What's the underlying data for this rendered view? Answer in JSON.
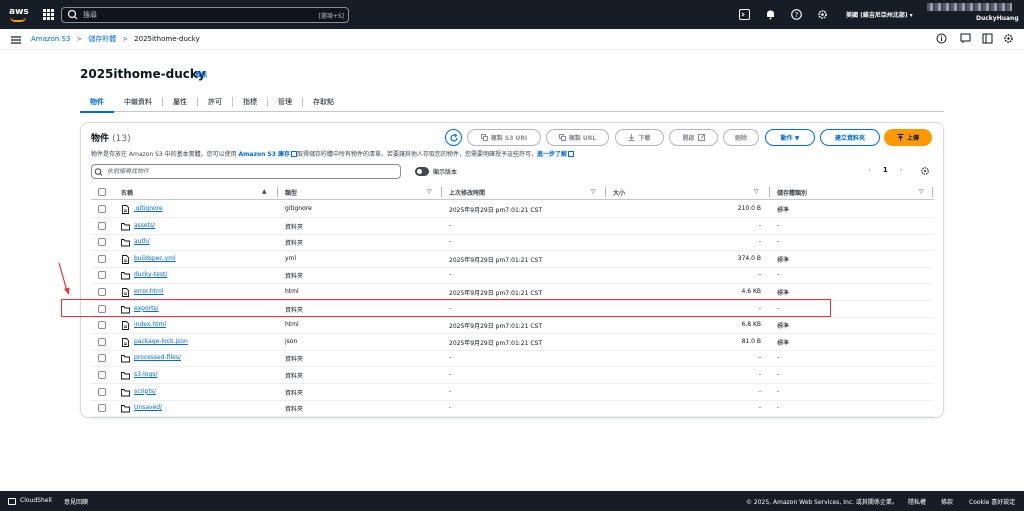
{
  "topnav": {
    "logo_text": "aws",
    "search_placeholder": "搜尋",
    "search_shortcut": "[選項+S]",
    "region": "美國 (維吉尼亞州北部) ▾",
    "username": "DuckyHuang"
  },
  "breadcrumb": {
    "items": [
      "Amazon S3",
      "儲存貯體",
      "2025ithome-ducky"
    ],
    "separator": ">"
  },
  "page": {
    "title": "2025ithome-ducky",
    "info": "資訊"
  },
  "tabs": [
    "物件",
    "中繼資料",
    "屬性",
    "許可",
    "指標",
    "管理",
    "存取點"
  ],
  "objects": {
    "title": "物件",
    "count": "(13)",
    "desc_pre": "物件是存放在 Amazon S3 中的基本實體。您可以使用 ",
    "desc_link1": "Amazon S3 庫存",
    "desc_mid": "取得儲存貯體中所有物件的清單。若要讓其他人存取您的物件，您需要明確授予這些許可，",
    "desc_link2": "進一步了解",
    "buttons": {
      "copy_s3_uri": "複製 S3 URI",
      "copy_url": "複製 URL",
      "download": "下載",
      "open": "開啟",
      "delete": "刪除",
      "actions": "動作 ▼",
      "create_folder": "建立資料夾",
      "upload": "上傳"
    },
    "filter_placeholder": "依前綴尋找物件",
    "show_versions": "顯示版本",
    "page_number": "1",
    "columns": {
      "name": "名稱",
      "type": "類型",
      "modified": "上次修改時間",
      "size": "大小",
      "storage_class": "儲存體類別"
    },
    "rows": [
      {
        "name": ".gitignore",
        "kind": "file",
        "type": "gitignore",
        "modified": "2025年9月29日 pm7:01:21 CST",
        "size": "210.0 B",
        "storage_class": "標準"
      },
      {
        "name": "assets/",
        "kind": "folder",
        "type": "資料夾",
        "modified": "-",
        "size": "-",
        "storage_class": "-"
      },
      {
        "name": "auth/",
        "kind": "folder",
        "type": "資料夾",
        "modified": "-",
        "size": "-",
        "storage_class": "-"
      },
      {
        "name": "buildspec.yml",
        "kind": "file",
        "type": "yml",
        "modified": "2025年9月29日 pm7:01:21 CST",
        "size": "374.0 B",
        "storage_class": "標準"
      },
      {
        "name": "ducky-test/",
        "kind": "folder",
        "type": "資料夾",
        "modified": "-",
        "size": "-",
        "storage_class": "-"
      },
      {
        "name": "error.html",
        "kind": "file",
        "type": "html",
        "modified": "2025年9月29日 pm7:01:21 CST",
        "size": "4.6 KB",
        "storage_class": "標準"
      },
      {
        "name": "exports/",
        "kind": "folder",
        "type": "資料夾",
        "modified": "-",
        "size": "-",
        "storage_class": "-"
      },
      {
        "name": "index.html",
        "kind": "file",
        "type": "html",
        "modified": "2025年9月29日 pm7:01:21 CST",
        "size": "6.8 KB",
        "storage_class": "標準"
      },
      {
        "name": "package-lock.json",
        "kind": "file",
        "type": "json",
        "modified": "2025年9月29日 pm7:01:21 CST",
        "size": "81.0 B",
        "storage_class": "標準"
      },
      {
        "name": "processed-files/",
        "kind": "folder",
        "type": "資料夾",
        "modified": "-",
        "size": "-",
        "storage_class": "-"
      },
      {
        "name": "s3-logs/",
        "kind": "folder",
        "type": "資料夾",
        "modified": "-",
        "size": "-",
        "storage_class": "-"
      },
      {
        "name": "scripts/",
        "kind": "folder",
        "type": "資料夾",
        "modified": "-",
        "size": "-",
        "storage_class": "-"
      },
      {
        "name": "Unsaved/",
        "kind": "folder",
        "type": "資料夾",
        "modified": "-",
        "size": "-",
        "storage_class": "-"
      }
    ]
  },
  "footer": {
    "cloudshell": "CloudShell",
    "feedback": "意見回饋",
    "copyright": "© 2025, Amazon Web Services, Inc. 或其關係企業。",
    "privacy": "隱私權",
    "terms": "條款",
    "cookie": "Cookie 喜好設定"
  },
  "colors": {
    "nav_bg": "#161d26",
    "link": "#006ce0",
    "upload_btn": "#ff9900",
    "highlight": "#e5333d"
  }
}
